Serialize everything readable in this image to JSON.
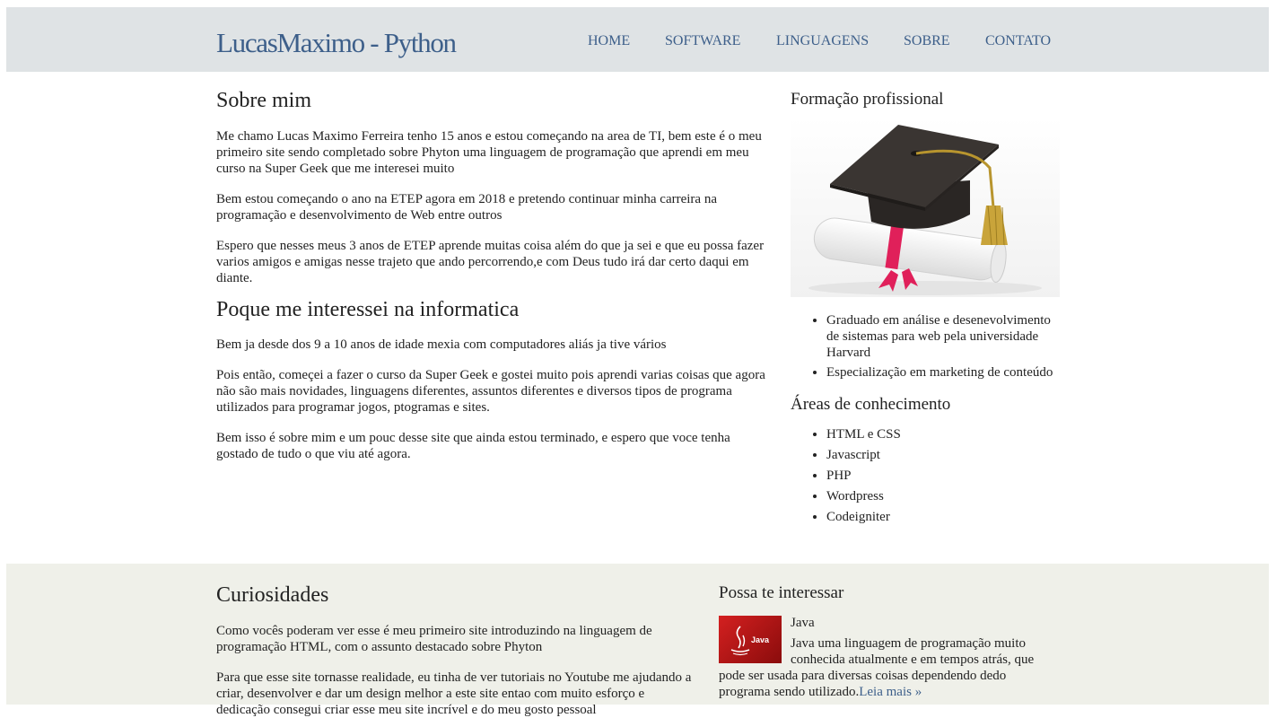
{
  "header": {
    "logo": "LucasMaximo - Python",
    "nav": [
      "HOME",
      "SOFTWARE",
      "LINGUAGENS",
      "SOBRE",
      "CONTATO"
    ]
  },
  "main": {
    "title1": "Sobre mim",
    "p1": "Me chamo Lucas Maximo Ferreira tenho 15 anos e estou começando na area de TI, bem este é o meu primeiro site sendo completado sobre Phyton uma linguagem de programação que aprendi em meu curso na Super Geek que me interesei muito",
    "p2": "Bem estou começando o ano na ETEP agora em 2018 e pretendo continuar minha carreira na programação e desenvolvimento de Web entre outros",
    "p3": "Espero que nesses meus 3 anos de ETEP aprende muitas coisa além do que ja sei e que eu possa fazer varios amigos e amigas nesse trajeto que ando percorrendo,e com Deus tudo irá dar certo daqui em diante.",
    "title2": "Poque me interessei na informatica",
    "p4": "Bem ja desde dos 9 a 10 anos de idade mexia com computadores aliás ja tive vários",
    "p5": "Pois então, começei a fazer o curso da Super Geek e gostei muito pois aprendi varias coisas que agora não são mais novidades, linguagens diferentes, assuntos diferentes e diversos tipos de programa utilizados para programar jogos, ptogramas e sites.",
    "p6": "Bem isso é sobre mim e um pouc desse site que ainda estou terminado, e espero que voce tenha gostado de tudo o que viu até agora."
  },
  "sidebar": {
    "title1": "Formação profissional",
    "formacao": [
      "Graduado em análise e desenevolvimento de sistemas para web pela universidade Harvard",
      "Especialização em marketing de conteúdo"
    ],
    "title2": "Áreas de conhecimento",
    "areas": [
      "HTML e CSS",
      "Javascript",
      "PHP",
      "Wordpress",
      "Codeigniter"
    ]
  },
  "footer": {
    "title": "Curiosidades",
    "p1": "Como vocês poderam ver esse é meu primeiro site introduzindo na linguagem de programação HTML, com o assunto destacado sobre Phyton",
    "p2": "Para que esse site tornasse realidade, eu tinha de ver tutoriais no Youtube me ajudando a criar, desenvolver e dar um design melhor a este site entao com muito esforço e dedicação consegui criar esse meu site incrível e do meu gosto pessoal",
    "side_title": "Possa te interessar",
    "item_title": "Java",
    "item_text": "Java uma linguagem de programação muito conhecida atualmente e em tempos atrás, que pode ser usada para diversas coisas dependendo dedo programa sendo utilizado.",
    "item_link": "Leia mais »",
    "thumb_label": "Java"
  },
  "colors": {
    "header_bg": "#dfe3e5",
    "footer_bg": "#eff0e9",
    "accent": "#3d5f8a",
    "java_red": "#c01818"
  }
}
